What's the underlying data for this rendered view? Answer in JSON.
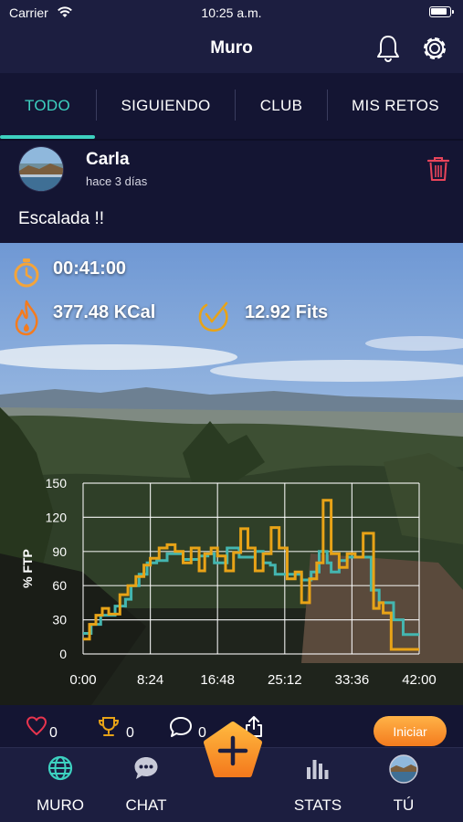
{
  "status": {
    "carrier": "Carrier",
    "time": "10:25 a.m."
  },
  "header": {
    "title": "Muro",
    "icons": [
      "bell-icon",
      "gear-icon"
    ]
  },
  "tabs": [
    {
      "label": "TODO",
      "active": true
    },
    {
      "label": "SIGUIENDO",
      "active": false
    },
    {
      "label": "CLUB",
      "active": false
    },
    {
      "label": "MIS RETOS",
      "active": false
    }
  ],
  "post": {
    "user": "Carla",
    "time": "hace 3 días",
    "text": "Escalada !!",
    "stats": {
      "duration": "00:41:00",
      "calories": "377.48 KCal",
      "fits": "12.92 Fits"
    }
  },
  "chart_data": {
    "type": "line",
    "ylabel": "% FTP",
    "xlabel": "",
    "x_ticks": [
      "0:00",
      "8:24",
      "16:48",
      "25:12",
      "33:36",
      "42:00"
    ],
    "y_ticks": [
      "0",
      "30",
      "60",
      "90",
      "120",
      "150"
    ],
    "xlim": [
      0,
      42
    ],
    "ylim": [
      0,
      150
    ],
    "grid": true,
    "series": [
      {
        "color": "#e8a317",
        "x": [
          0,
          0.8,
          1.6,
          2.4,
          3.2,
          4.6,
          5.6,
          6.6,
          7.6,
          8.4,
          9.5,
          10.5,
          11.5,
          12.5,
          13.5,
          14.5,
          15.2,
          16.0,
          16.8,
          17.8,
          18.8,
          19.7,
          20.6,
          21.5,
          22.5,
          23.5,
          24.5,
          25.5,
          26.5,
          27.3,
          28.3,
          29.2,
          30.0,
          31.0,
          32.0,
          33.0,
          34.0,
          35.0,
          36.3,
          37.0,
          37.5,
          38.5,
          42.0
        ],
        "y": [
          13,
          26,
          34,
          40,
          35,
          52,
          60,
          68,
          78,
          84,
          93,
          96,
          90,
          80,
          93,
          73,
          88,
          93,
          86,
          73,
          89,
          110,
          93,
          73,
          88,
          111,
          93,
          66,
          72,
          45,
          66,
          80,
          135,
          88,
          76,
          88,
          85,
          106,
          40,
          45,
          36,
          4,
          4
        ]
      },
      {
        "color": "#44b6b0",
        "x": [
          0,
          1.0,
          2.2,
          4.0,
          5.3,
          6.0,
          7.0,
          8.0,
          9.2,
          10.5,
          12.5,
          14.5,
          15.6,
          16.4,
          18.0,
          19.5,
          21.5,
          22.5,
          23.4,
          24.0,
          25.5,
          26.5,
          27.3,
          28.5,
          29.5,
          30.5,
          31.0,
          32.0,
          33.0,
          35.0,
          36.0,
          37.0,
          38.0,
          38.8,
          40.0,
          42.0
        ],
        "y": [
          18,
          26,
          34,
          42,
          48,
          60,
          70,
          80,
          82,
          88,
          83,
          86,
          88,
          80,
          93,
          85,
          90,
          80,
          78,
          70,
          70,
          70,
          65,
          72,
          90,
          80,
          72,
          82,
          85,
          85,
          56,
          45,
          45,
          30,
          17,
          17
        ]
      }
    ]
  },
  "actions": {
    "likes": "0",
    "trophies": "0",
    "comments": "0",
    "start_label": "Iniciar"
  },
  "nav": [
    {
      "label": "MURO"
    },
    {
      "label": "CHAT"
    },
    {
      "label": "STATS"
    },
    {
      "label": "TÚ"
    }
  ]
}
